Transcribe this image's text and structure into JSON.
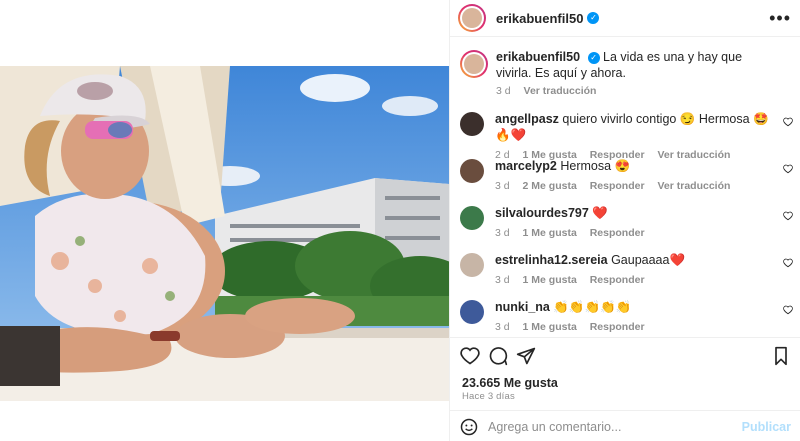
{
  "post": {
    "username": "erikabuenfil50",
    "verified": true
  },
  "caption": {
    "username": "erikabuenfil50",
    "text": "La vida es una y hay que vivirla. Es aquí y ahora.",
    "age": "3 d",
    "translate": "Ver traducción"
  },
  "comments": [
    {
      "username": "angellpasz",
      "text": "quiero vivirlo contigo 😏 Hermosa 🤩🔥❤️",
      "age": "2 d",
      "likes": "1 Me gusta",
      "reply": "Responder",
      "translate": "Ver traducción"
    },
    {
      "username": "marcelyp2",
      "text": "Hermosa 😍",
      "age": "3 d",
      "likes": "2 Me gusta",
      "reply": "Responder",
      "translate": "Ver traducción"
    },
    {
      "username": "silvalourdes797",
      "text": "❤️",
      "age": "3 d",
      "likes": "1 Me gusta",
      "reply": "Responder",
      "translate": ""
    },
    {
      "username": "estrelinha12.sereia",
      "text": "Gaupaaaa❤️",
      "age": "3 d",
      "likes": "1 Me gusta",
      "reply": "Responder",
      "translate": ""
    },
    {
      "username": "nunki_na",
      "text": "👏👏👏👏👏",
      "age": "3 d",
      "likes": "1 Me gusta",
      "reply": "Responder",
      "translate": ""
    }
  ],
  "stats": {
    "likes": "23.665 Me gusta",
    "posted": "Hace 3 días"
  },
  "composer": {
    "placeholder": "Agrega un comentario...",
    "publish": "Publicar"
  },
  "colors": {
    "accent": "#0095f6",
    "muted": "#8e8e8e",
    "heart": "#ed4956"
  }
}
